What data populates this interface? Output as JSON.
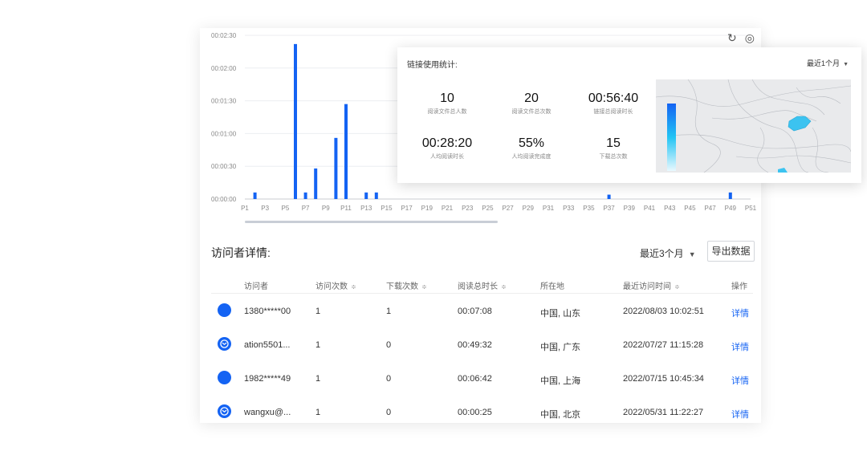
{
  "chart_data": {
    "type": "bar",
    "categories": [
      "P1",
      "P2",
      "P3",
      "P4",
      "P5",
      "P6",
      "P7",
      "P8",
      "P9",
      "P10",
      "P11",
      "P12",
      "P13",
      "P14",
      "P15",
      "P16",
      "P17",
      "P18",
      "P19",
      "P20",
      "P21",
      "P22",
      "P23",
      "P24",
      "P25",
      "P26",
      "P27",
      "P28",
      "P29",
      "P30",
      "P31",
      "P32",
      "P33",
      "P34",
      "P35",
      "P36",
      "P37",
      "P38",
      "P39",
      "P40",
      "P41",
      "P42",
      "P43",
      "P44",
      "P45",
      "P46",
      "P47",
      "P48",
      "P49",
      "P50",
      "P51"
    ],
    "tick_labels": [
      "P1",
      "P3",
      "P5",
      "P7",
      "P9",
      "P11",
      "P13",
      "P15",
      "P17",
      "P19",
      "P21",
      "P23",
      "P25",
      "P27",
      "P29",
      "P31",
      "P33",
      "P35",
      "P37",
      "P39",
      "P41",
      "P43",
      "P45",
      "P47",
      "P49",
      "P51"
    ],
    "values": [
      0,
      6,
      0,
      0,
      0,
      142,
      6,
      28,
      0,
      56,
      87,
      0,
      6,
      6,
      0,
      0,
      0,
      0,
      0,
      0,
      0,
      0,
      0,
      0,
      0,
      0,
      0,
      0,
      0,
      0,
      0,
      0,
      0,
      0,
      0,
      0,
      4,
      0,
      0,
      0,
      0,
      0,
      0,
      0,
      0,
      0,
      0,
      0,
      6,
      0,
      0
    ],
    "y_ticks": [
      "00:00:00",
      "00:00:30",
      "00:01:00",
      "00:01:30",
      "00:02:00",
      "00:02:30"
    ],
    "ylim": [
      0,
      150
    ],
    "unit": "seconds",
    "grid": true
  },
  "chart_toolbar": {
    "refresh_icon": "↻",
    "settings_icon": "◎"
  },
  "visitors": {
    "title": "访问者详情:",
    "range": "最近3个月",
    "export": "导出数据",
    "headers": {
      "visitor": "访问者",
      "visits": "访问次数",
      "downloads": "下载次数",
      "read_time": "阅读总时长",
      "location": "所在地",
      "last_visit": "最近访问时间",
      "action": "操作"
    },
    "sort_icon": "≑",
    "rows": [
      {
        "type": "phone",
        "name": "1380*****00",
        "visits": "1",
        "downloads": "1",
        "read_time": "00:07:08",
        "location": "中国, 山东",
        "last_visit": "2022/08/03 10:02:51",
        "action": "详情"
      },
      {
        "type": "mail",
        "name": "ation5501...",
        "visits": "1",
        "downloads": "0",
        "read_time": "00:49:32",
        "location": "中国, 广东",
        "last_visit": "2022/07/27 11:15:28",
        "action": "详情"
      },
      {
        "type": "phone",
        "name": "1982*****49",
        "visits": "1",
        "downloads": "0",
        "read_time": "00:06:42",
        "location": "中国, 上海",
        "last_visit": "2022/07/15 10:45:34",
        "action": "详情"
      },
      {
        "type": "mail",
        "name": "wangxu@...",
        "visits": "1",
        "downloads": "0",
        "read_time": "00:00:25",
        "location": "中国, 北京",
        "last_visit": "2022/05/31 11:22:27",
        "action": "详情"
      }
    ]
  },
  "link_stats": {
    "title": "链接使用统计:",
    "range": "最近1个月",
    "stats": [
      {
        "value": "10",
        "label": "阅读文件总人数"
      },
      {
        "value": "20",
        "label": "阅读文件总次数"
      },
      {
        "value": "00:56:40",
        "label": "链接总阅读时长"
      },
      {
        "value": "00:28:20",
        "label": "人均阅读时长"
      },
      {
        "value": "55%",
        "label": "人均阅读完成度"
      },
      {
        "value": "15",
        "label": "下载总次数"
      }
    ]
  },
  "colors": {
    "accent": "#1463f3",
    "map_highlight": "#3cc3f0",
    "map_bg": "#e9eaec"
  }
}
